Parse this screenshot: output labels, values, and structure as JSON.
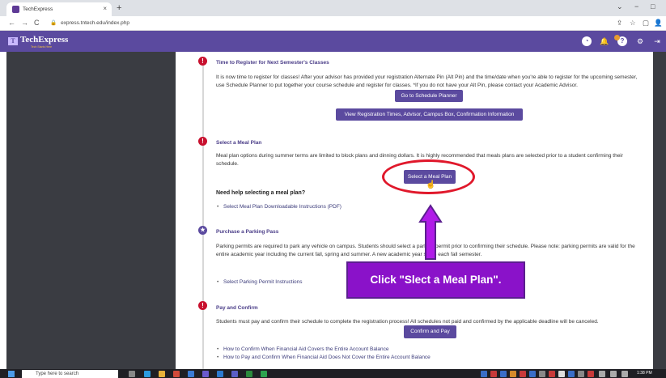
{
  "browser": {
    "tab_title": "TechExpress",
    "tab_close": "×",
    "new_tab": "+",
    "url": "express.tntech.edu/index.php",
    "win_min": "−",
    "win_max": "□",
    "win_chev": "⌄"
  },
  "header": {
    "brand": "TechExpress",
    "tagline": "Tech Starts Here"
  },
  "steps": [
    {
      "title": "Time to Register for Next Semester's Classes",
      "body": "It is now time to register for classes! After your advisor has provided your registration Alternate Pin (Alt Pin) and the time/date when you're able to register for the upcoming semester, use Schedule Planner to put together your course schedule and register for classes. *If you do not have your Alt Pin, please contact your Academic Advisor.",
      "btn1": "Go to Schedule Planner",
      "btn2": "View Registration Times, Advisor, Campus Box, Confirmation Information"
    },
    {
      "title": "Select a Meal Plan",
      "body": "Meal plan options during summer terms are limited to block plans and dinning dollars. It is highly recommended that meals plans are selected prior to a student confirming their schedule.",
      "btn": "Select a Meal Plan",
      "help_title": "Need help selecting a meal plan?",
      "link": "Select Meal Plan Downloadable Instructions (PDF)"
    },
    {
      "title": "Purchase a Parking Pass",
      "body": "Parking permits are required to park any vehicle on campus. Students should select a parking permit prior to confirming their schedule. Please note: parking permits are valid for the entire academic year including the current fall, spring and summer. A new academic year starts each fall semester.",
      "link": "Select Parking Permit Instructions"
    },
    {
      "title": "Pay and Confirm",
      "body": "Students must pay and confirm their schedule to complete the registration process! All schedules not paid and confirmed by the applicable deadline will be canceled.",
      "btn": "Confirm and Pay",
      "link1": "How to Confirm When Financial Aid Covers the Entire Account Balance",
      "link2": "How to Pay and Confirm When Financial Aid Does Not Cover the Entire Account Balance"
    }
  ],
  "callout": "Click \"Slect a Meal Plan\".",
  "taskbar": {
    "search_placeholder": "Type here to search",
    "time": "1:38 PM"
  },
  "colors": {
    "brand": "#5b4a9f",
    "alert": "#c8102e",
    "callout": "#8a12c9"
  }
}
